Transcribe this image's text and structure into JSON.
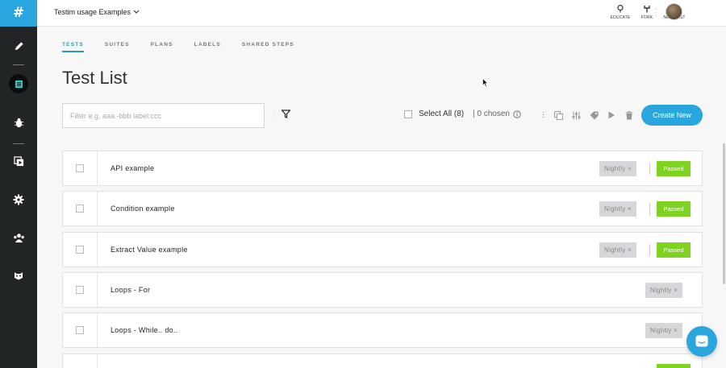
{
  "app": {
    "logo": "#",
    "project_name": "Testim usage Examples"
  },
  "topbar": {
    "actions": [
      {
        "label": "EDUCATE",
        "icon": "lightbulb-icon"
      },
      {
        "label": "FORK",
        "icon": "fork-icon"
      },
      {
        "label": "NEW TEST",
        "icon": "plus-icon"
      }
    ]
  },
  "sidebar": {
    "items": [
      {
        "name": "edit",
        "icon": "pencil-icon"
      },
      {
        "name": "tests",
        "icon": "list-icon",
        "active": true
      },
      {
        "name": "bugs",
        "icon": "bug-icon"
      },
      {
        "name": "runs",
        "icon": "play-stack-icon"
      },
      {
        "name": "settings",
        "icon": "gear-icon"
      },
      {
        "name": "team",
        "icon": "team-icon"
      },
      {
        "name": "extension",
        "icon": "mask-icon"
      }
    ]
  },
  "tabs": [
    {
      "label": "TESTS",
      "active": true
    },
    {
      "label": "SUITES"
    },
    {
      "label": "PLANS"
    },
    {
      "label": "LABELS"
    },
    {
      "label": "SHARED STEPS"
    }
  ],
  "page": {
    "title": "Test List"
  },
  "filter": {
    "placeholder": "Filter e.g. aaa -bbb label:ccc"
  },
  "selection": {
    "select_all_label": "Select All (8)",
    "chosen_label": "| 0 chosen"
  },
  "create_button": "Create New",
  "tests": [
    {
      "name": "API example",
      "tag": "Nightly ×",
      "status": "Passed"
    },
    {
      "name": "Condition example",
      "tag": "Nightly ×",
      "status": "Passed"
    },
    {
      "name": "Extract Value example",
      "tag": "Nightly ×",
      "status": "Passed"
    },
    {
      "name": "Loops - For",
      "tag": "Nightly ×",
      "status": ""
    },
    {
      "name": "Loops - While.. do..",
      "tag": "Nightly ×",
      "status": ""
    }
  ],
  "colors": {
    "accent": "#2aa6df",
    "passed": "#7ed321",
    "sidebar": "#222526",
    "tab_active": "#23a0b8"
  }
}
